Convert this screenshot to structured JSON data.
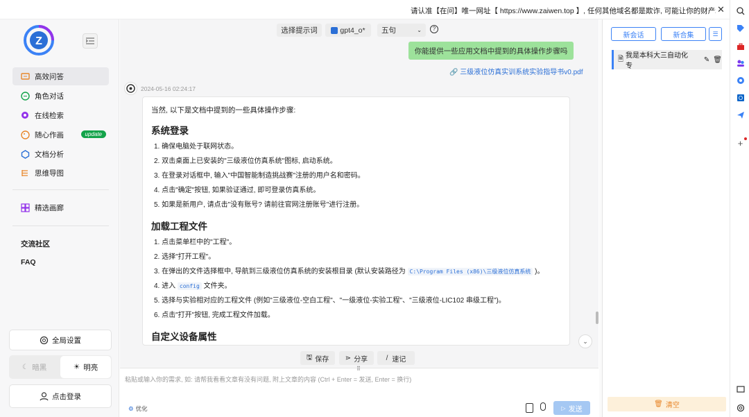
{
  "topbar": {
    "notice": "请认准【在问】唯一网址【 https://www.zaiwen.top 】, 任何其他域名都是欺诈, 可能让你的财产和隐私受到"
  },
  "sidebar": {
    "items": [
      {
        "label": "高效问答",
        "icon": "chat-icon",
        "color": "#e8872b"
      },
      {
        "label": "角色对话",
        "icon": "role-icon",
        "color": "#13a34a"
      },
      {
        "label": "在线检索",
        "icon": "search-globe-icon",
        "color": "#9333ea"
      },
      {
        "label": "随心作画",
        "icon": "palette-icon",
        "color": "#e8872b"
      },
      {
        "label": "文档分析",
        "icon": "document-icon",
        "color": "#2b6fd6"
      },
      {
        "label": "思维导图",
        "icon": "mindmap-icon",
        "color": "#e8872b"
      },
      {
        "label": "精选画廊",
        "icon": "gallery-icon",
        "color": "#9333ea"
      }
    ],
    "badge": "update",
    "links": [
      "交流社区",
      "FAQ"
    ],
    "settings": "全局设置",
    "theme_dark": "暗黑",
    "theme_light": "明亮",
    "login": "点击登录"
  },
  "toolbar": {
    "prompt": "选择提示词",
    "model": "gpt4_o*",
    "rounds": "五句"
  },
  "chat": {
    "question": "你能提供一些应用文档中提到的具体操作步骤吗",
    "pdf": "三级液位仿真实训系统实验指导书v0.pdf",
    "timestamp": "2024-05-16 02:24:17",
    "intro": "当然, 以下是文档中提到的一些具体操作步骤:",
    "s1_title": "系统登录",
    "s1_items": [
      "1. 确保电脑处于联网状态。",
      "2. 双击桌面上已安装的\"三级液位仿真系统\"图标, 启动系统。",
      "3. 在登录对话框中, 输入\"中国智能制造挑战赛\"注册的用户名和密码。",
      "4. 点击\"确定\"按钮, 如果验证通过, 即可登录仿真系统。",
      "5. 如果是新用户, 请点击\"没有账号? 请前往官网注册账号\"进行注册。"
    ],
    "s2_title": "加载工程文件",
    "s2_items": [
      "1. 点击菜单栏中的\"工程\"。",
      "2. 选择\"打开工程\"。"
    ],
    "s2_i3_pre": "3. 在弹出的文件选择框中, 导航到三级液位仿真系统的安装根目录 (默认安装路径为",
    "s2_i3_code": "C:\\Program Files (x86)\\三级液位仿真系统",
    "s2_i3_post": ")。",
    "s2_i4_pre": "4. 进入",
    "s2_i4_code": "config",
    "s2_i4_post": "文件夹。",
    "s2_items_b": [
      "5. 选择与实验相对应的工程文件 (例如\"三级液位-空白工程\"、\"一级液位-实验工程\"、\"三级液位-LIC102 串级工程\")。",
      "6. 点击\"打开\"按钮, 完成工程文件加载。"
    ],
    "s3_title": "自定义设备属性",
    "actions": [
      "保存",
      "分享",
      "速记"
    ],
    "input_placeholder": "粘贴或输入你的需求, 如: 请帮我看看文章有没有问题, 附上文章的内容 (Ctrl + Enter = 发送, Enter = 换行)",
    "optimize": "优化",
    "send": "发送"
  },
  "right": {
    "new_chat": "新会话",
    "new_set": "新合集",
    "conversation": "我是本科大三自动化专",
    "clear": "清空"
  }
}
